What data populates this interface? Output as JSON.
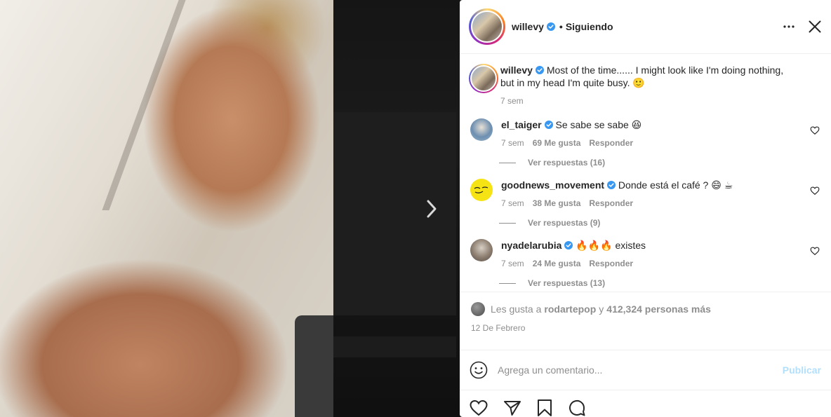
{
  "header": {
    "username": "willevy",
    "separator": "•",
    "follow_state": "Siguiendo",
    "icons": {
      "more": "more-horizontal-icon",
      "close": "close-icon",
      "verified": "verified-badge-icon"
    }
  },
  "caption": {
    "username": "willevy",
    "text": "Most of the time...... I might look like I'm doing nothing, but in my head I'm quite busy.",
    "emoji": "🙂",
    "time": "7 sem"
  },
  "comments": [
    {
      "username": "el_taiger",
      "text": "Se sabe se sabe",
      "emoji": "😆",
      "time": "7 sem",
      "likes": "69 Me gusta",
      "reply_label": "Responder",
      "view_replies": "Ver respuestas (16)"
    },
    {
      "username": "goodnews_movement",
      "text": "Donde está el café ?",
      "emoji": "😄 ☕",
      "time": "7 sem",
      "likes": "38 Me gusta",
      "reply_label": "Responder",
      "view_replies": "Ver respuestas (9)"
    },
    {
      "username": "nyadelarubia",
      "text": "existes",
      "emoji": "🔥🔥🔥",
      "time": "7 sem",
      "likes": "24 Me gusta",
      "reply_label": "Responder",
      "view_replies": "Ver respuestas (13)"
    }
  ],
  "likes": {
    "prefix": "Les gusta a",
    "user": "rodartepop",
    "conjunction": "y",
    "others": "412,324 personas más"
  },
  "post_date": "12 De Febrero",
  "add_comment": {
    "placeholder": "Agrega un comentario...",
    "publish_label": "Publicar"
  },
  "colors": {
    "verified": "#3897f0",
    "link_disabled": "#b2dffc",
    "muted": "#8e8e8e"
  }
}
